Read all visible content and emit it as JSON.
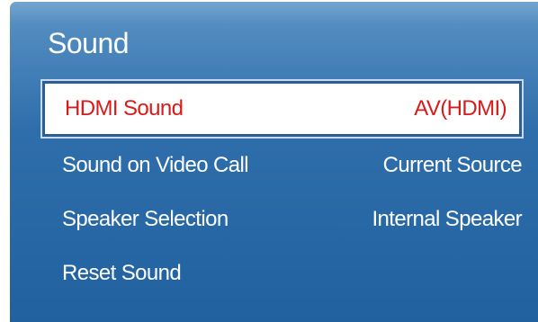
{
  "menu": {
    "title": "Sound",
    "items": [
      {
        "label": "HDMI Sound",
        "value": "AV(HDMI)"
      },
      {
        "label": "Sound on Video Call",
        "value": "Current Source"
      },
      {
        "label": "Speaker Selection",
        "value": "Internal Speaker"
      },
      {
        "label": "Reset Sound",
        "value": ""
      }
    ]
  },
  "colors": {
    "panel_top": "#5a93c5",
    "panel_bottom": "#21619f",
    "selected_background": "#ffffff",
    "selected_text": "#d9191a",
    "text": "#ffffff"
  }
}
